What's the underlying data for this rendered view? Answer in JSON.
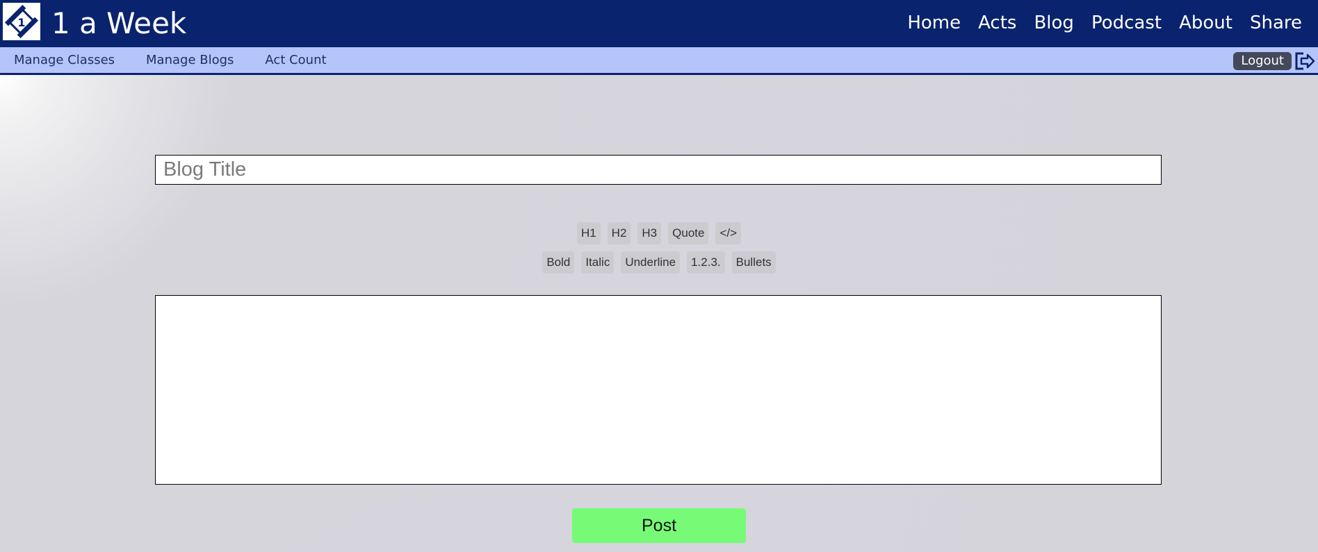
{
  "header": {
    "site_title": "1 a Week",
    "logo_text": "1",
    "nav": [
      {
        "label": "Home"
      },
      {
        "label": "Acts"
      },
      {
        "label": "Blog"
      },
      {
        "label": "Podcast"
      },
      {
        "label": "About"
      },
      {
        "label": "Share"
      }
    ]
  },
  "subnav": {
    "items": [
      {
        "label": "Manage Classes"
      },
      {
        "label": "Manage Blogs"
      },
      {
        "label": "Act Count"
      }
    ],
    "logout_label": "Logout",
    "logout_icon": "logout-icon"
  },
  "editor": {
    "title_placeholder": "Blog Title",
    "title_value": "",
    "toolbar_row1": [
      {
        "label": "H1"
      },
      {
        "label": "H2"
      },
      {
        "label": "H3"
      },
      {
        "label": "Quote"
      },
      {
        "label": "</>"
      }
    ],
    "toolbar_row2": [
      {
        "label": "Bold"
      },
      {
        "label": "Italic"
      },
      {
        "label": "Underline"
      },
      {
        "label": "1.2.3."
      },
      {
        "label": "Bullets"
      }
    ],
    "body_value": "",
    "post_label": "Post"
  },
  "colors": {
    "header_bg": "#0a236e",
    "subbar_bg": "#b5c5fb",
    "logout_bg": "#43485a",
    "post_bg": "#77fb77",
    "page_bg": "#d5d4db"
  }
}
